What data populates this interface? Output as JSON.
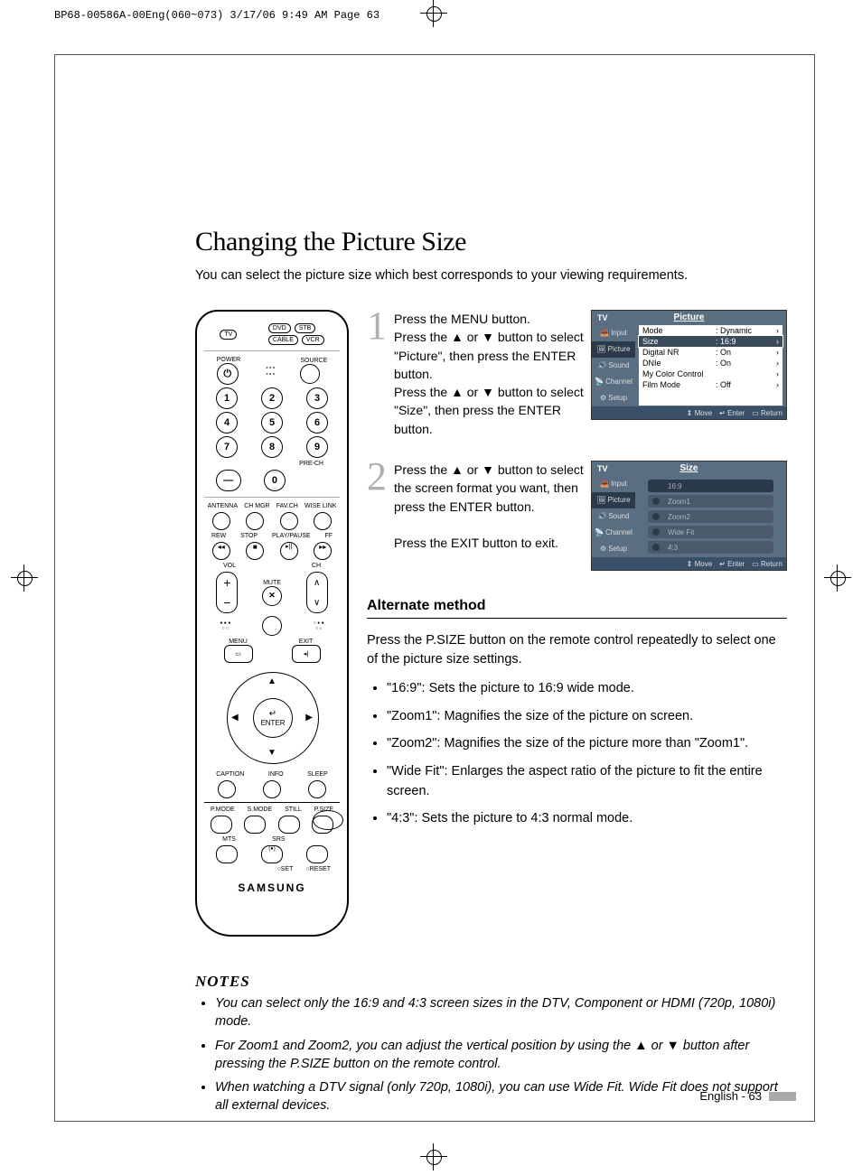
{
  "print_header": "BP68-00586A-00Eng(060~073)  3/17/06  9:49 AM  Page 63",
  "title": "Changing the Picture Size",
  "intro": "You can select the picture size which best corresponds to your viewing requirements.",
  "steps": [
    {
      "num": "1",
      "text": "Press the MENU button.\nPress the ▲ or ▼ button to select \"Picture\", then press the ENTER button.\nPress the ▲ or ▼ button to select \"Size\", then press the ENTER button."
    },
    {
      "num": "2",
      "text": "Press the ▲ or ▼ button to select the screen format you want, then press the ENTER button.\n\nPress the EXIT button to exit."
    }
  ],
  "osd1": {
    "tv": "TV",
    "title": "Picture",
    "side": [
      "Input",
      "Picture",
      "Sound",
      "Channel",
      "Setup"
    ],
    "rows": [
      {
        "k": "Mode",
        "v": ": Dynamic",
        "arr": "›"
      },
      {
        "k": "Size",
        "v": ": 16:9",
        "arr": "›",
        "hl": true
      },
      {
        "k": "Digital NR",
        "v": ": On",
        "arr": "›"
      },
      {
        "k": "DNIe",
        "v": ": On",
        "arr": "›"
      },
      {
        "k": "My Color Control",
        "v": "",
        "arr": "›"
      },
      {
        "k": "Film Mode",
        "v": ": Off",
        "arr": "›"
      }
    ],
    "foot": {
      "move": "Move",
      "enter": "Enter",
      "return": "Return"
    }
  },
  "osd2": {
    "tv": "TV",
    "title": "Size",
    "side": [
      "Input",
      "Picture",
      "Sound",
      "Channel",
      "Setup"
    ],
    "options": [
      "16:9",
      "Zoom1",
      "Zoom2",
      "Wide Fit",
      "4:3"
    ],
    "foot": {
      "move": "Move",
      "enter": "Enter",
      "return": "Return"
    }
  },
  "alt_method_title": "Alternate method",
  "alt_method_intro": "Press the P.SIZE button on the remote control repeatedly to select one of the picture size settings.",
  "alt_method_bullets": [
    "\"16:9\": Sets the picture to 16:9 wide mode.",
    "\"Zoom1\": Magnifies the size of the picture on screen.",
    "\"Zoom2\": Magnifies the size of the picture more than \"Zoom1\".",
    "\"Wide Fit\": Enlarges the aspect ratio of the picture to fit the entire screen.",
    "\"4:3\": Sets the picture to 4:3 normal mode."
  ],
  "notes_title": "NOTES",
  "notes": [
    "You can select only the 16:9 and 4:3 screen sizes in the DTV, Component or HDMI (720p, 1080i) mode.",
    "For Zoom1 and Zoom2, you can adjust the vertical position by using the ▲ or ▼ button after pressing the P.SIZE button on the remote control.",
    "When watching a DTV signal (only 720p, 1080i), you can use Wide Fit. Wide Fit does not support all external devices."
  ],
  "remote": {
    "tv": "TV",
    "dvd": "DVD",
    "stb": "STB",
    "cable": "CABLE",
    "vcr": "VCR",
    "power": "POWER",
    "source": "SOURCE",
    "prech": "PRE-CH",
    "antenna": "ANTENNA",
    "chmgr": "CH MGR",
    "favch": "FAV.CH",
    "wiselink": "WISE LINK",
    "rew": "REW",
    "stop": "STOP",
    "play": "PLAY/PAUSE",
    "ff": "FF",
    "vol": "VOL",
    "mute": "MUTE",
    "ch": "CH",
    "menu": "MENU",
    "exit": "EXIT",
    "enter": "ENTER",
    "caption": "CAPTION",
    "info": "INFO",
    "sleep": "SLEEP",
    "pmode": "P.MODE",
    "smode": "S.MODE",
    "still": "STILL",
    "psize": "P.SIZE",
    "mts": "MTS",
    "srs": "SRS",
    "set": "SET",
    "reset": "RESET",
    "logo": "SAMSUNG",
    "enter_icon": "↵"
  },
  "page_footer": "English - 63"
}
